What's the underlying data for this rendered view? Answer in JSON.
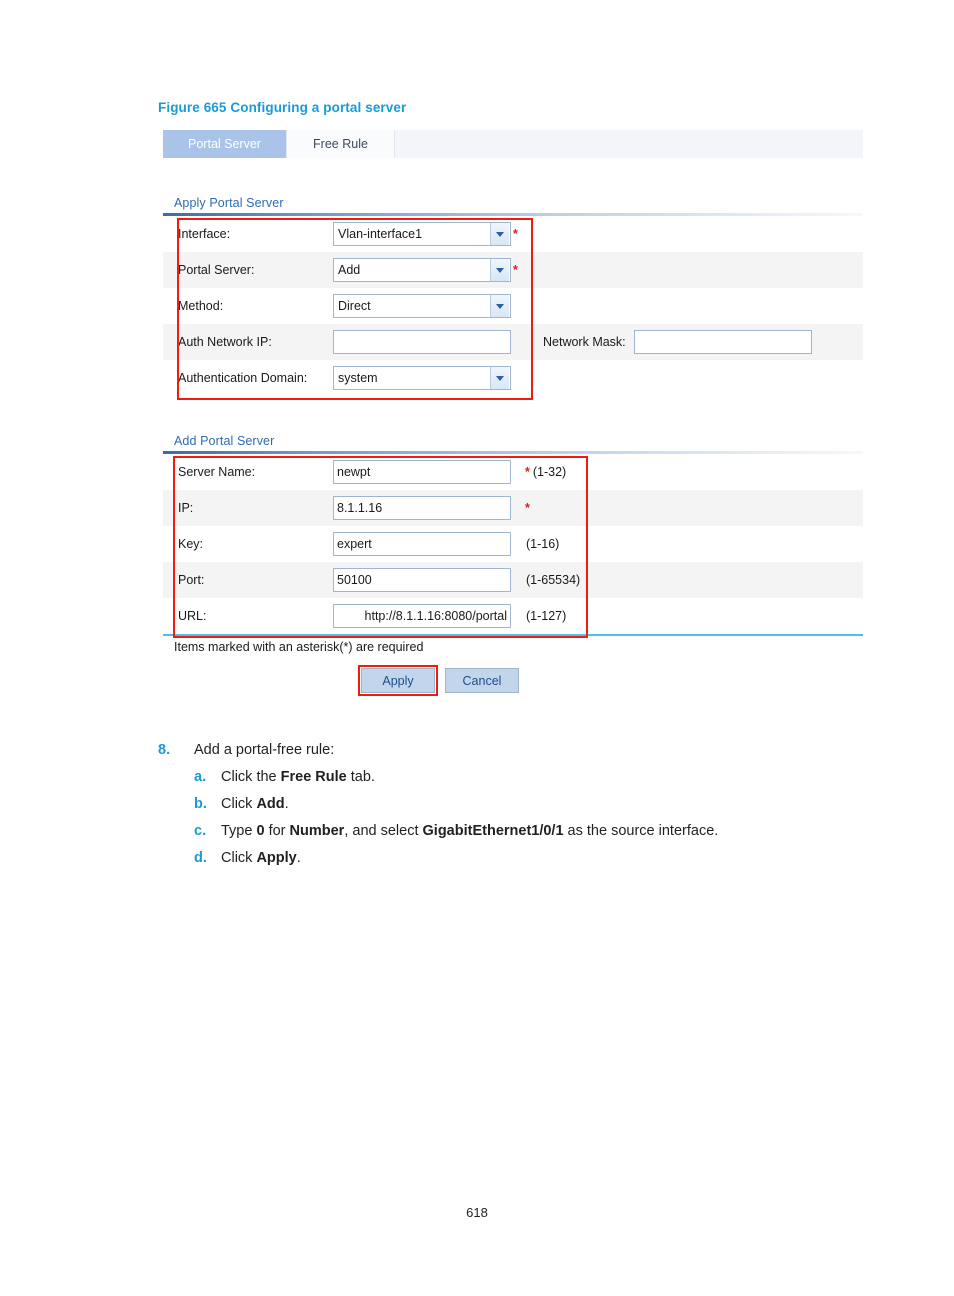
{
  "figure": {
    "caption": "Figure 665 Configuring a portal server"
  },
  "colors": {
    "caption_blue": "#1b9ad6",
    "section_blue": "#2f6cb4",
    "active_tab_bg": "#a9c4e8",
    "required_red": "#e8190f",
    "annotation_red": "#f01c10",
    "button_blue": "#c3d5ea",
    "rule_blue": "#4ec0ee",
    "row_alt_bg": "#f4f4f4"
  },
  "tabs": [
    {
      "label": "Portal Server",
      "active": true
    },
    {
      "label": "Free Rule",
      "active": false
    }
  ],
  "apply_portal_server": {
    "title": "Apply Portal Server",
    "rows": [
      {
        "label": "Interface:",
        "control": "select",
        "value": "Vlan-interface1",
        "required": true,
        "suffix": ""
      },
      {
        "label": "Portal Server:",
        "control": "select",
        "value": "Add",
        "required": true,
        "suffix": ""
      },
      {
        "label": "Method:",
        "control": "select",
        "value": "Direct",
        "required": false,
        "suffix": ""
      },
      {
        "label": "Auth Network IP:",
        "control": "text",
        "value": "",
        "placeholder": "",
        "required": false,
        "suffix": "",
        "extra_label": "Network Mask:",
        "extra_value": "",
        "extra_placeholder": ""
      },
      {
        "label": "Authentication Domain:",
        "control": "select",
        "value": "system",
        "required": false,
        "suffix": ""
      }
    ]
  },
  "add_portal_server": {
    "title": "Add Portal Server",
    "rows": [
      {
        "label": "Server Name:",
        "control": "text",
        "value": "newpt",
        "placeholder": "",
        "required": true,
        "suffix": "(1-32)"
      },
      {
        "label": "IP:",
        "control": "text",
        "value": "8.1.1.16",
        "placeholder": "",
        "required": true,
        "suffix": ""
      },
      {
        "label": "Key:",
        "control": "text",
        "value": "expert",
        "placeholder": "",
        "required": false,
        "suffix": "(1-16)"
      },
      {
        "label": "Port:",
        "control": "text",
        "value": "50100",
        "placeholder": "",
        "required": false,
        "suffix": "(1-65534)"
      },
      {
        "label": "URL:",
        "control": "text",
        "value": "http://8.1.1.16:8080/portal",
        "placeholder": "",
        "required": false,
        "suffix": "(1-127)"
      }
    ]
  },
  "footer": {
    "note": "Items marked with an asterisk(*) are required",
    "apply_label": "Apply",
    "cancel_label": "Cancel"
  },
  "steps": {
    "number": "8.",
    "title": "Add a portal-free rule:",
    "substeps": [
      {
        "marker": "a.",
        "parts": [
          {
            "t": "Click the ",
            "b": false
          },
          {
            "t": "Free Rule",
            "b": true
          },
          {
            "t": " tab.",
            "b": false
          }
        ]
      },
      {
        "marker": "b.",
        "parts": [
          {
            "t": "Click ",
            "b": false
          },
          {
            "t": "Add",
            "b": true
          },
          {
            "t": ".",
            "b": false
          }
        ]
      },
      {
        "marker": "c.",
        "parts": [
          {
            "t": "Type ",
            "b": false
          },
          {
            "t": "0",
            "b": true
          },
          {
            "t": " for ",
            "b": false
          },
          {
            "t": "Number",
            "b": true
          },
          {
            "t": ", and select ",
            "b": false
          },
          {
            "t": "GigabitEthernet1/0/1",
            "b": true
          },
          {
            "t": " as the source interface.",
            "b": false
          }
        ]
      },
      {
        "marker": "d.",
        "parts": [
          {
            "t": "Click ",
            "b": false
          },
          {
            "t": "Apply",
            "b": true
          },
          {
            "t": ".",
            "b": false
          }
        ]
      }
    ]
  },
  "page_number": "618"
}
